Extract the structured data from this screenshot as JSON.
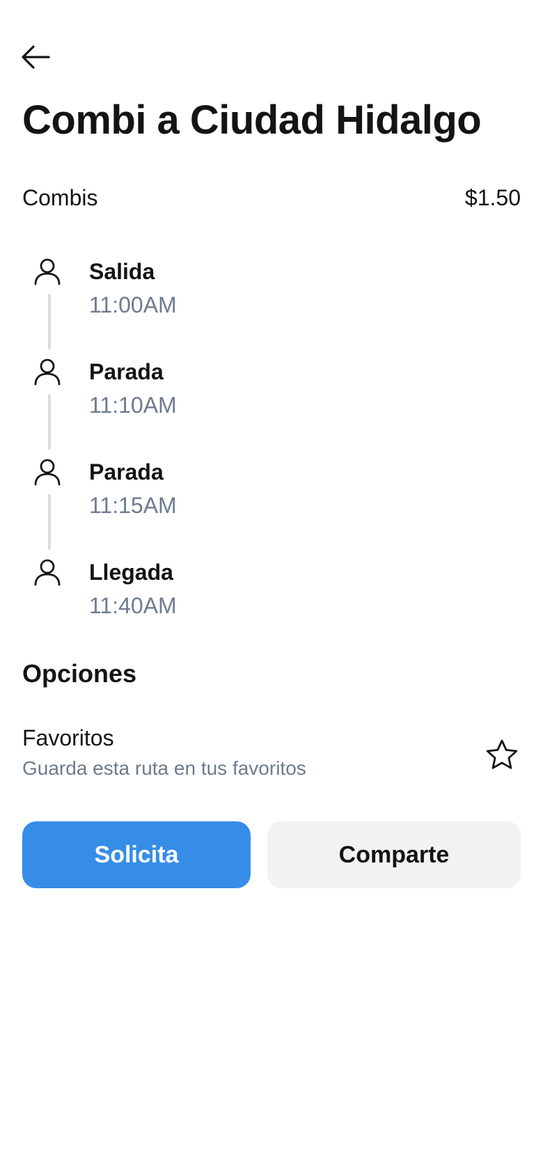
{
  "header": {
    "back_icon": "arrow-left-icon",
    "title": "Combi a Ciudad Hidalgo"
  },
  "fare": {
    "mode": "Combis",
    "price": "$1.50"
  },
  "stops": [
    {
      "icon": "person-icon",
      "name": "Salida",
      "time": "11:00AM"
    },
    {
      "icon": "person-icon",
      "name": "Parada",
      "time": "11:10AM"
    },
    {
      "icon": "person-icon",
      "name": "Parada",
      "time": "11:15AM"
    },
    {
      "icon": "person-icon",
      "name": "Llegada",
      "time": "11:40AM"
    }
  ],
  "options": {
    "title": "Opciones",
    "favorites": {
      "label": "Favoritos",
      "description": "Guarda esta ruta en tus favoritos",
      "icon": "star-icon"
    }
  },
  "actions": {
    "request_label": "Solicita",
    "share_label": "Comparte"
  },
  "colors": {
    "primary": "#358de8",
    "secondary_bg": "#f1f2f4",
    "muted_text": "#6e7b8e",
    "text": "#141414",
    "timeline_line": "#dcdcdc"
  }
}
